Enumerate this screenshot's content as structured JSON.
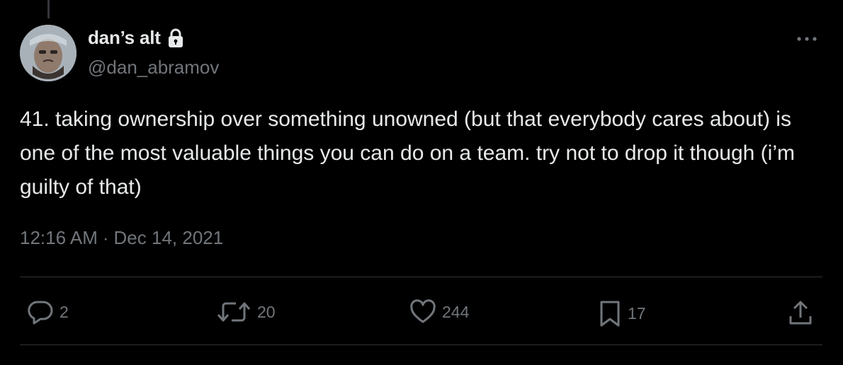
{
  "colors": {
    "background": "#000000",
    "text_primary": "#e7e9ea",
    "text_secondary": "#71767b",
    "divider": "#2f3336"
  },
  "author": {
    "display_name": "dan’s alt",
    "handle": "@dan_abramov",
    "protected_icon": "lock-icon",
    "avatar_icon": "avatar"
  },
  "tweet": {
    "text": "41. taking ownership over something unowned (but that everybody cares about) is one of the most valuable things you can do on a team. try not to drop it though (i’m guilty of that)",
    "time": "12:16 AM",
    "separator": "·",
    "date": "Dec 14, 2021"
  },
  "actions": {
    "reply": {
      "icon": "reply-icon",
      "count": "2"
    },
    "retweet": {
      "icon": "retweet-icon",
      "count": "20"
    },
    "like": {
      "icon": "heart-icon",
      "count": "244"
    },
    "bookmark": {
      "icon": "bookmark-icon",
      "count": "17"
    },
    "share": {
      "icon": "share-icon"
    }
  },
  "menu": {
    "icon": "more-icon"
  }
}
